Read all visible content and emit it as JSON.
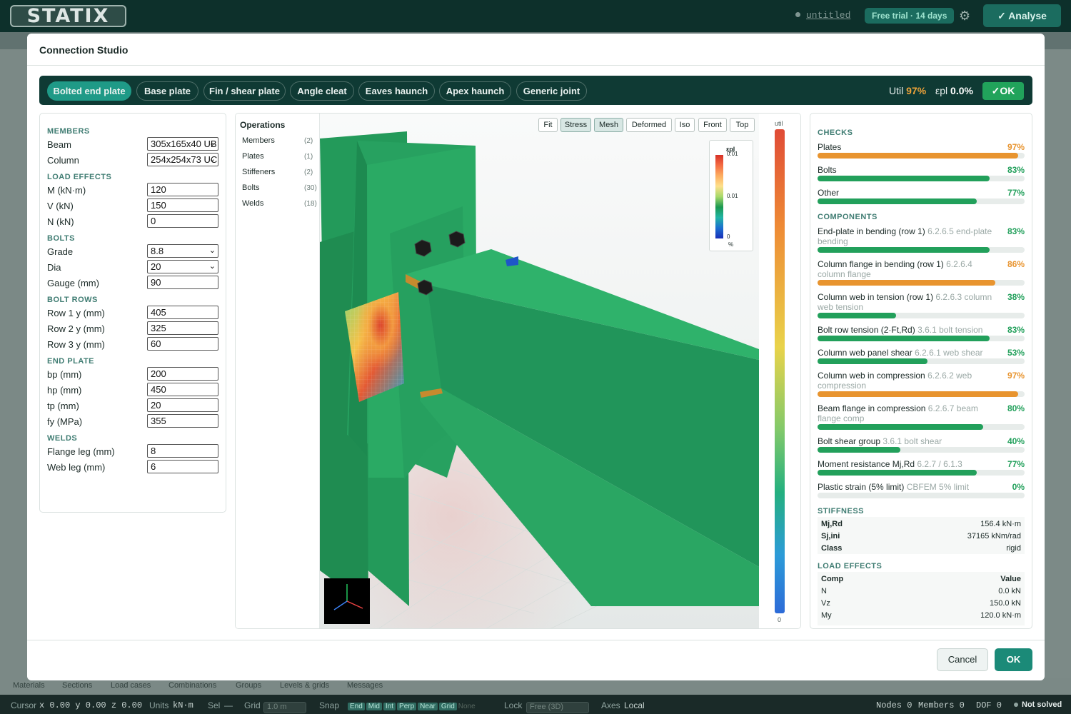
{
  "app": {
    "logo": "STATIX",
    "document_name": "untitled",
    "trial_badge": "Free trial · 14 days",
    "analyse_label": "✓  Analyse"
  },
  "background_tabs": [
    "Materials",
    "Sections",
    "Load cases",
    "Combinations",
    "Groups",
    "Levels & grids",
    "Messages"
  ],
  "statusbar": {
    "cursor_label": "Cursor",
    "cursor_value": "x 0.00 y 0.00 z 0.00",
    "units_label": "Units",
    "units_value": "kN·m",
    "sel_label": "Sel",
    "sel_value": "—",
    "grid_label": "Grid",
    "grid_value": "1.0 m",
    "snap_label": "Snap",
    "snap_options": [
      "End",
      "Mid",
      "Int",
      "Perp",
      "Near",
      "Grid",
      "None"
    ],
    "lock_label": "Lock",
    "lock_value": "Free (3D)",
    "axes_label": "Axes",
    "axes_value": "Local",
    "nodes": "Nodes 0",
    "members": "Members 0",
    "dof": "DOF 0",
    "solve_state": "Not solved"
  },
  "modal": {
    "title": "Connection Studio",
    "connection_types": [
      "Bolted end plate",
      "Base plate",
      "Fin / shear plate",
      "Angle cleat",
      "Eaves haunch",
      "Apex haunch",
      "Generic joint"
    ],
    "active_type": "Bolted end plate",
    "util_label": "Util",
    "util_value": "97%",
    "epl_label": "εpl",
    "epl_value": "0.0%",
    "status": "✓OK",
    "cancel_label": "Cancel",
    "ok_label": "OK"
  },
  "params": {
    "members_h": "MEMBERS",
    "beam_label": "Beam",
    "beam_value": "305x165x40 UB",
    "column_label": "Column",
    "column_value": "254x254x73 UC",
    "loads_h": "LOAD EFFECTS",
    "m_label": "M (kN·m)",
    "m_value": "120",
    "v_label": "V (kN)",
    "v_value": "150",
    "n_label": "N (kN)",
    "n_value": "0",
    "bolts_h": "BOLTS",
    "grade_label": "Grade",
    "grade_value": "8.8",
    "dia_label": "Dia",
    "dia_value": "20",
    "gauge_label": "Gauge (mm)",
    "gauge_value": "90",
    "rows_h": "BOLT ROWS",
    "row1_label": "Row 1 y (mm)",
    "row1_value": "405",
    "row2_label": "Row 2 y (mm)",
    "row2_value": "325",
    "row3_label": "Row 3 y (mm)",
    "row3_value": "60",
    "plate_h": "END PLATE",
    "bp_label": "bp (mm)",
    "bp_value": "200",
    "hp_label": "hp (mm)",
    "hp_value": "450",
    "tp_label": "tp (mm)",
    "tp_value": "20",
    "fy_label": "fy (MPa)",
    "fy_value": "355",
    "welds_h": "WELDS",
    "flange_label": "Flange leg (mm)",
    "flange_value": "8",
    "web_label": "Web leg (mm)",
    "web_value": "6"
  },
  "operations": {
    "title": "Operations",
    "items": [
      {
        "label": "Members",
        "count": "(2)"
      },
      {
        "label": "Plates",
        "count": "(1)"
      },
      {
        "label": "Stiffeners",
        "count": "(2)"
      },
      {
        "label": "Bolts",
        "count": "(30)"
      },
      {
        "label": "Welds",
        "count": "(18)"
      }
    ]
  },
  "view_buttons": [
    "Fit",
    "Stress",
    "Mesh",
    "Deformed",
    "Iso",
    "Front",
    "Top"
  ],
  "view_buttons_on": [
    "Stress",
    "Mesh"
  ],
  "strain_legend": {
    "title": "εpl",
    "top": "0.01",
    "mid": "0.01",
    "bottom": "0",
    "unit": "%"
  },
  "util_scale": {
    "title": "util",
    "bottom": "0"
  },
  "checks": {
    "title": "CHECKS",
    "items": [
      {
        "name": "Plates",
        "pct": "97%",
        "value": 0.97,
        "color": "#e8942f"
      },
      {
        "name": "Bolts",
        "pct": "83%",
        "value": 0.83,
        "color": "#22a05b"
      },
      {
        "name": "Other",
        "pct": "77%",
        "value": 0.77,
        "color": "#22a05b"
      }
    ]
  },
  "components": {
    "title": "COMPONENTS",
    "items": [
      {
        "name": "End-plate in bending (row 1)",
        "ref": "6.2.6.5 end-plate bending",
        "pct": "83%",
        "value": 0.83,
        "color": "#22a05b"
      },
      {
        "name": "Column flange in bending (row 1)",
        "ref": "6.2.6.4 column flange",
        "pct": "86%",
        "value": 0.86,
        "color": "#e8942f"
      },
      {
        "name": "Column web in tension (row 1)",
        "ref": "6.2.6.3 column web tension",
        "pct": "38%",
        "value": 0.38,
        "color": "#22a05b"
      },
      {
        "name": "Bolt row tension (2·Ft,Rd)",
        "ref": "3.6.1 bolt tension",
        "pct": "83%",
        "value": 0.83,
        "color": "#22a05b"
      },
      {
        "name": "Column web panel shear",
        "ref": "6.2.6.1 web shear",
        "pct": "53%",
        "value": 0.53,
        "color": "#22a05b"
      },
      {
        "name": "Column web in compression",
        "ref": "6.2.6.2 web compression",
        "pct": "97%",
        "value": 0.97,
        "color": "#e8942f"
      },
      {
        "name": "Beam flange in compression",
        "ref": "6.2.6.7 beam flange comp",
        "pct": "80%",
        "value": 0.8,
        "color": "#22a05b"
      },
      {
        "name": "Bolt shear group",
        "ref": "3.6.1 bolt shear",
        "pct": "40%",
        "value": 0.4,
        "color": "#22a05b"
      },
      {
        "name": "Moment resistance Mj,Rd",
        "ref": "6.2.7 / 6.1.3",
        "pct": "77%",
        "value": 0.77,
        "color": "#22a05b"
      },
      {
        "name": "Plastic strain (5% limit)",
        "ref": "CBFEM 5% limit",
        "pct": "0%",
        "value": 0.0,
        "color": "#22a05b"
      }
    ]
  },
  "stiffness": {
    "title": "STIFFNESS",
    "rows": [
      {
        "k": "Mj,Rd",
        "v": "156.4 kN·m"
      },
      {
        "k": "Sj,ini",
        "v": "37165 kNm/rad"
      },
      {
        "k": "Class",
        "v": "rigid"
      }
    ]
  },
  "load_effects": {
    "title": "LOAD EFFECTS",
    "col_comp": "Comp",
    "col_value": "Value",
    "rows": [
      {
        "k": "N",
        "v": "0.0 kN"
      },
      {
        "k": "Vz",
        "v": "150.0 kN"
      },
      {
        "k": "My",
        "v": "120.0 kN·m"
      }
    ]
  }
}
